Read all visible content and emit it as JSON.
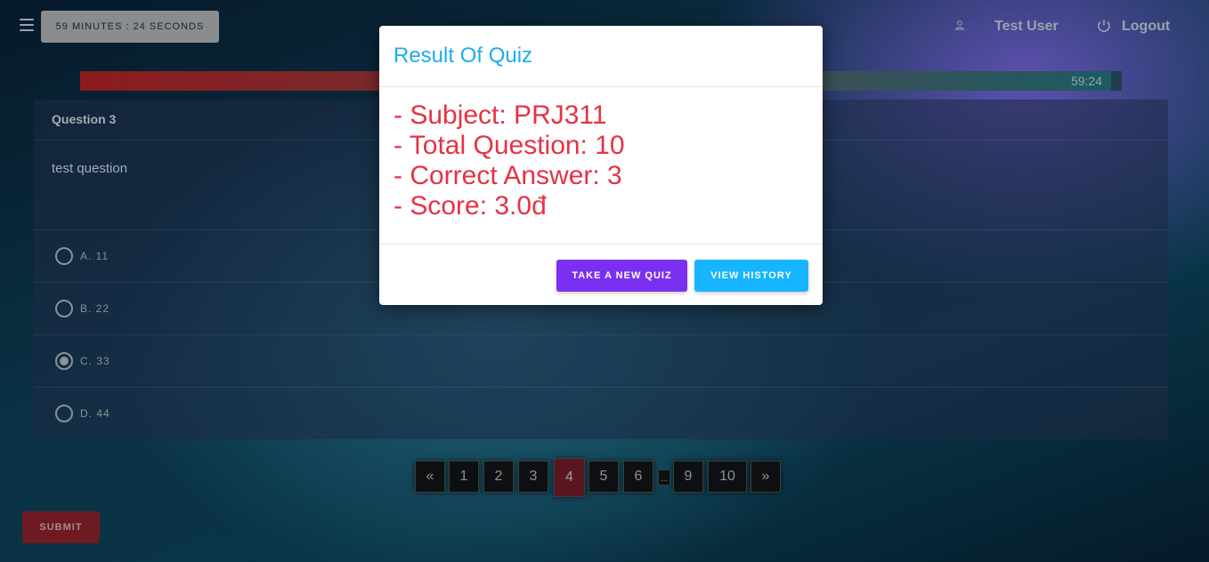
{
  "header": {
    "timer_badge": "59 MINUTES : 24 SECONDS",
    "user_name": "Test User",
    "logout_label": "Logout"
  },
  "progress": {
    "time_left": "59:24",
    "fraction_remaining": 0.99
  },
  "question": {
    "title": "Question 3",
    "text": "test question",
    "options": [
      {
        "label": "A. 11",
        "selected": false
      },
      {
        "label": "B. 22",
        "selected": false
      },
      {
        "label": "C. 33",
        "selected": true
      },
      {
        "label": "D. 44",
        "selected": false
      }
    ]
  },
  "pagination": {
    "prev": "«",
    "pages": [
      "1",
      "2",
      "3",
      "4",
      "5",
      "6"
    ],
    "ellipsis": "...",
    "tail_pages": [
      "9",
      "10"
    ],
    "next": "»",
    "active_page": "4"
  },
  "submit_label": "SUBMIT",
  "modal": {
    "title": "Result Of Quiz",
    "lines": [
      "- Subject: PRJ311",
      "- Total Question: 10",
      "- Correct Answer: 3",
      "- Score: 3.0đ"
    ],
    "new_quiz_label": "TAKE A NEW QUIZ",
    "history_label": "VIEW HISTORY"
  },
  "colors": {
    "modal_title": "#1aaef0",
    "result_text": "#e53345",
    "new_quiz_button": "#7b2ff0",
    "history_button": "#17b5ff",
    "submit_button": "#6e1a22"
  }
}
